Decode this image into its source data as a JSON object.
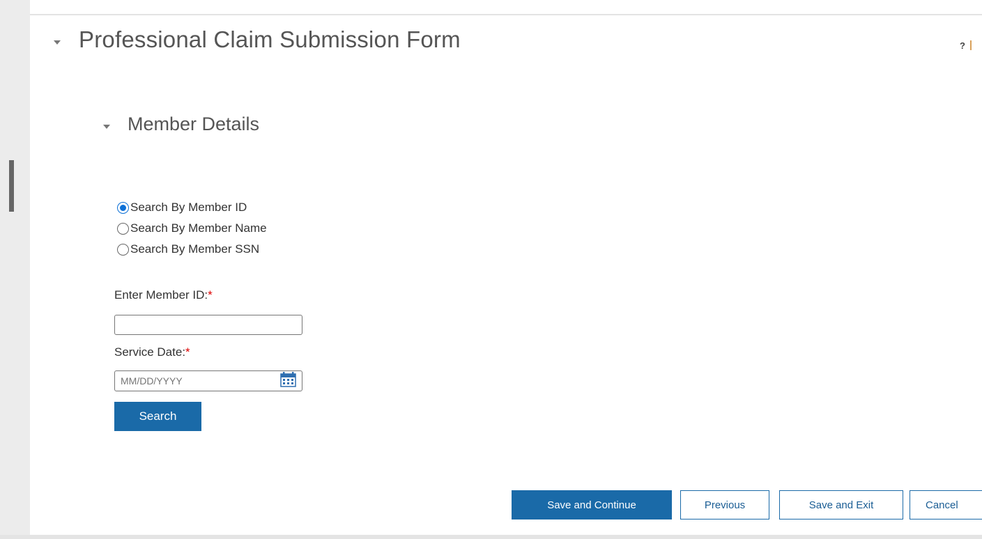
{
  "form": {
    "title": "Professional Claim Submission Form",
    "help_label": "?"
  },
  "section": {
    "title": "Member Details"
  },
  "search_options": [
    {
      "label": "Search By Member ID",
      "checked": true
    },
    {
      "label": "Search By Member Name",
      "checked": false
    },
    {
      "label": "Search By Member SSN",
      "checked": false
    }
  ],
  "fields": {
    "member_id_label": "Enter Member ID:",
    "member_id_value": "",
    "service_date_label": "Service Date:",
    "service_date_placeholder": "MM/DD/YYYY",
    "required_marker": "*"
  },
  "buttons": {
    "search": "Search",
    "save_continue": "Save and Continue",
    "previous": "Previous",
    "save_exit": "Save and Exit",
    "cancel": "Cancel"
  },
  "colors": {
    "primary": "#1a6aa8",
    "radio_checked": "#0a6fd6",
    "required": "#dd0000"
  },
  "icons": {
    "calendar": "calendar-icon",
    "collapse": "caret-down-icon"
  }
}
